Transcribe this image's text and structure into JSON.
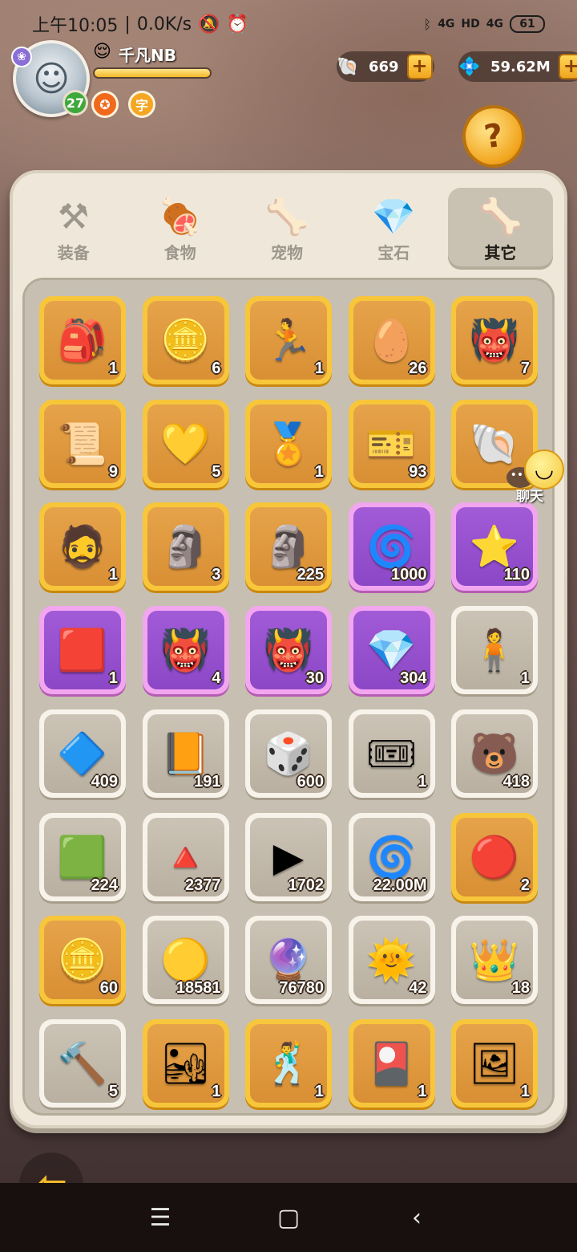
{
  "status_bar": {
    "time": "上午10:05",
    "speed": "0.0K/s",
    "network_1": "4G",
    "hd": "HD",
    "network_2": "4G",
    "battery": "61"
  },
  "player": {
    "name": "千凡NB",
    "level": "27",
    "xp_fraction": 1.0,
    "badge_2": "✪",
    "badge_3": "字"
  },
  "currencies": [
    {
      "icon": "shell-icon",
      "value": "669"
    },
    {
      "icon": "diamond-icon",
      "value": "59.62M"
    }
  ],
  "tabs": [
    {
      "label": "装备",
      "icon": "hammer-icon"
    },
    {
      "label": "食物",
      "icon": "food-bowl-icon"
    },
    {
      "label": "宠物",
      "icon": "pet-skull-icon"
    },
    {
      "label": "宝石",
      "icon": "gem-icon"
    },
    {
      "label": "其它",
      "icon": "bone-icon",
      "active": true
    }
  ],
  "help_icon": "?",
  "chat": {
    "label": "聊天"
  },
  "items": [
    {
      "icon": "backpack-icon",
      "glyph": "🎒",
      "count": "1",
      "rarity": "gold"
    },
    {
      "icon": "gold-coin-icon",
      "glyph": "🪙",
      "count": "6",
      "rarity": "gold"
    },
    {
      "icon": "blue-skill-orb-icon",
      "glyph": "🏃",
      "count": "1",
      "rarity": "gold"
    },
    {
      "icon": "egg-nest-icon",
      "glyph": "🥚",
      "count": "26",
      "rarity": "gold"
    },
    {
      "icon": "monster-chest-icon",
      "glyph": "👹",
      "count": "7",
      "rarity": "gold"
    },
    {
      "icon": "castle-scroll-icon",
      "glyph": "📜",
      "count": "9",
      "rarity": "gold"
    },
    {
      "icon": "amber-crystal-icon",
      "glyph": "💛",
      "count": "5",
      "rarity": "gold"
    },
    {
      "icon": "medal-icon",
      "glyph": "🏅",
      "count": "1",
      "rarity": "gold"
    },
    {
      "icon": "blue-castle-ticket-icon",
      "glyph": "🎫",
      "count": "93",
      "rarity": "gold"
    },
    {
      "icon": "shell-coin-icon",
      "glyph": "🐚",
      "count": "",
      "rarity": "gold"
    },
    {
      "icon": "caveman-portrait-icon",
      "glyph": "🧔",
      "count": "1",
      "rarity": "gold"
    },
    {
      "icon": "green-totem-icon",
      "glyph": "🗿",
      "count": "3",
      "rarity": "gold"
    },
    {
      "icon": "stone-idol-icon",
      "glyph": "🗿",
      "count": "225",
      "rarity": "gold"
    },
    {
      "icon": "pinwheel-icon",
      "glyph": "🌀",
      "count": "1000",
      "rarity": "purple"
    },
    {
      "icon": "star-sticks-icon",
      "glyph": "⭐",
      "count": "110",
      "rarity": "purple"
    },
    {
      "icon": "red-card-icon",
      "glyph": "🟥",
      "count": "1",
      "rarity": "purple"
    },
    {
      "icon": "monster-chest-icon",
      "glyph": "👹",
      "count": "4",
      "rarity": "purple"
    },
    {
      "icon": "monster-chest-icon",
      "glyph": "👹",
      "count": "30",
      "rarity": "purple"
    },
    {
      "icon": "pink-crystal-icon",
      "glyph": "💎",
      "count": "304",
      "rarity": "purple"
    },
    {
      "icon": "figure-card-icon",
      "glyph": "🧍",
      "count": "1",
      "rarity": "white"
    },
    {
      "icon": "blue-rune-stone-icon",
      "glyph": "🔷",
      "count": "409",
      "rarity": "white"
    },
    {
      "icon": "orange-scroll-icon",
      "glyph": "📙",
      "count": "191",
      "rarity": "white"
    },
    {
      "icon": "dice-icon",
      "glyph": "🎲",
      "count": "600",
      "rarity": "white"
    },
    {
      "icon": "purple-ticket-icon",
      "glyph": "🎟",
      "count": "1",
      "rarity": "white"
    },
    {
      "icon": "bear-ticket-icon",
      "glyph": "🐻",
      "count": "418",
      "rarity": "white"
    },
    {
      "icon": "green-ticket-icon",
      "glyph": "🟩",
      "count": "224",
      "rarity": "white"
    },
    {
      "icon": "red-ticket-icon",
      "glyph": "🔺",
      "count": "2377",
      "rarity": "white"
    },
    {
      "icon": "play-ticket-icon",
      "glyph": "▶",
      "count": "1702",
      "rarity": "white"
    },
    {
      "icon": "spiral-stone-icon",
      "glyph": "🌀",
      "count": "22.00M",
      "rarity": "white"
    },
    {
      "icon": "fire-orb-icon",
      "glyph": "🔴",
      "count": "2",
      "rarity": "gold"
    },
    {
      "icon": "gold-rune-coin-icon",
      "glyph": "🪙",
      "count": "60",
      "rarity": "gold"
    },
    {
      "icon": "gold-char-coin-icon",
      "glyph": "🟡",
      "count": "18581",
      "rarity": "white"
    },
    {
      "icon": "rainbow-crystal-icon",
      "glyph": "🔮",
      "count": "76780",
      "rarity": "white"
    },
    {
      "icon": "sun-gem-icon",
      "glyph": "🌞",
      "count": "42",
      "rarity": "white"
    },
    {
      "icon": "crown-stone-icon",
      "glyph": "👑",
      "count": "18",
      "rarity": "white"
    },
    {
      "icon": "hammer-stone-icon",
      "glyph": "🔨",
      "count": "5",
      "rarity": "white"
    },
    {
      "icon": "desert-scene-icon",
      "glyph": "🏜",
      "count": "1",
      "rarity": "gold"
    },
    {
      "icon": "dance-card-icon",
      "glyph": "🕺",
      "count": "1",
      "rarity": "gold"
    },
    {
      "icon": "team-card-icon",
      "glyph": "🎴",
      "count": "1",
      "rarity": "gold"
    },
    {
      "icon": "photo-card-icon",
      "glyph": "🖼",
      "count": "1",
      "rarity": "gold"
    }
  ],
  "nav": {
    "menu": "☰",
    "home": "▢",
    "back": "‹"
  }
}
